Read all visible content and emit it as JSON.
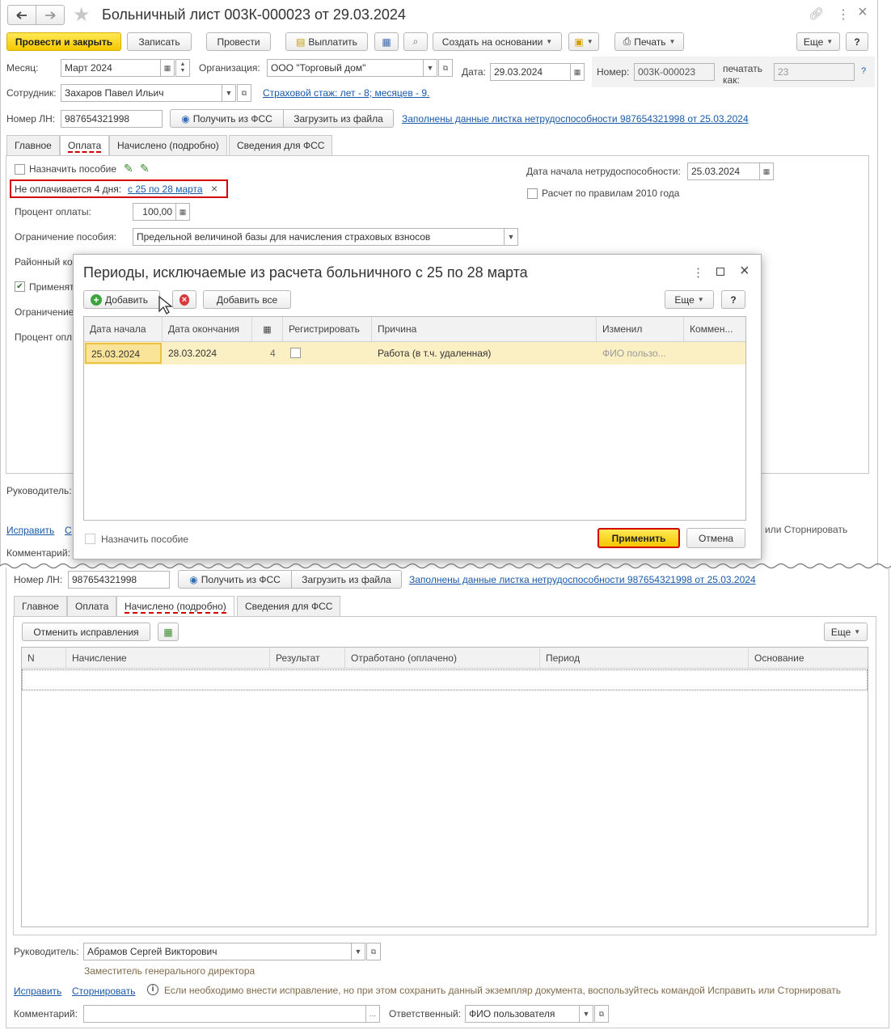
{
  "window": {
    "title": "Больничный лист 003К-000023 от 29.03.2024",
    "back_icon": "arrow-left",
    "forward_icon": "arrow-right",
    "star_icon": "star",
    "link_icon": "link",
    "more_icon": "⋮",
    "close_icon": "×"
  },
  "toolbar": {
    "post_close": "Провести и закрыть",
    "save": "Записать",
    "post": "Провести",
    "pay": "Выплатить",
    "create_based": "Создать на основании",
    "print": "Печать",
    "more": "Еще",
    "help": "?"
  },
  "header": {
    "month_label": "Месяц:",
    "month_value": "Март 2024",
    "org_label": "Организация:",
    "org_value": "ООО \"Торговый дом\"",
    "date_label": "Дата:",
    "date_value": "29.03.2024",
    "number_label": "Номер:",
    "number_value": "003К-000023",
    "print_as_label": "печатать как:",
    "print_as_value": "23",
    "question": "?",
    "employee_label": "Сотрудник:",
    "employee_value": "Захаров Павел Ильич",
    "insurance_link": "Страховой стаж: лет - 8; месяцев - 9.",
    "ln_label": "Номер ЛН:",
    "ln_value": "987654321998",
    "get_fss": "Получить из ФСС",
    "load_file": "Загрузить из файла",
    "filled_link": "Заполнены данные листка нетрудоспособности 987654321998 от 25.03.2024"
  },
  "tabs": [
    "Главное",
    "Оплата",
    "Начислено (подробно)",
    "Сведения для ФСС"
  ],
  "payment": {
    "assign_benefit": "Назначить пособие",
    "not_paid": "Не оплачивается 4 дня:",
    "not_paid_link": "с 25 по 28 марта",
    "percent_label": "Процент оплаты:",
    "percent_value": "100,00",
    "limit_label": "Ограничение пособия:",
    "limit_value": "Предельной величиной базы для начисления страховых взносов",
    "regional_label": "Районный ко",
    "apply_label": "Применят",
    "limit2_label": "Ограничение",
    "percent2_label": "Процент опл",
    "start_label": "Дата начала нетрудоспособности:",
    "start_value": "25.03.2024",
    "rules_2010": "Расчет по правилам 2010 года",
    "manager_label_cut": "Руководитель:",
    "fix_link": "Исправить",
    "storno_cut": "С",
    "storno_tail": "или Сторнировать",
    "comment_label": "Комментарий:"
  },
  "dialog": {
    "title": "Периоды, исключаемые из расчета больничного с 25 по 28 марта",
    "add": "Добавить",
    "add_all": "Добавить все",
    "more": "Еще",
    "help": "?",
    "columns": [
      "Дата начала",
      "Дата окончания",
      "calendar-icon",
      "Регистрировать",
      "Причина",
      "Изменил",
      "Коммен..."
    ],
    "rows": [
      {
        "start": "25.03.2024",
        "end": "28.03.2024",
        "days": "4",
        "register": false,
        "reason": "Работа (в т.ч. удаленная)",
        "changed": "ФИО пользо...",
        "comment": ""
      }
    ],
    "assign_benefit": "Назначить пособие",
    "apply": "Применить",
    "cancel": "Отмена"
  },
  "bottom": {
    "ln_label": "Номер ЛН:",
    "ln_value": "987654321998",
    "get_fss": "Получить из ФСС",
    "load_file": "Загрузить из файла",
    "filled_link": "Заполнены данные листка нетрудоспособности 987654321998 от 25.03.2024",
    "cancel_fix": "Отменить исправления",
    "more": "Еще",
    "columns": [
      "N",
      "Начисление",
      "Результат",
      "Отработано (оплачено)",
      "Период",
      "Основание"
    ],
    "manager_label": "Руководитель:",
    "manager_value": "Абрамов Сергей Викторович",
    "manager_position": "Заместитель генерального директора",
    "fix_link": "Исправить",
    "storno_link": "Сторнировать",
    "info_text": "Если необходимо внести исправление, но при этом сохранить данный экземпляр документа, воспользуйтесь командой Исправить или Сторнировать",
    "comment_label": "Комментарий:",
    "comment_value": "",
    "responsible_label": "Ответственный:",
    "responsible_value": "ФИО пользователя"
  }
}
